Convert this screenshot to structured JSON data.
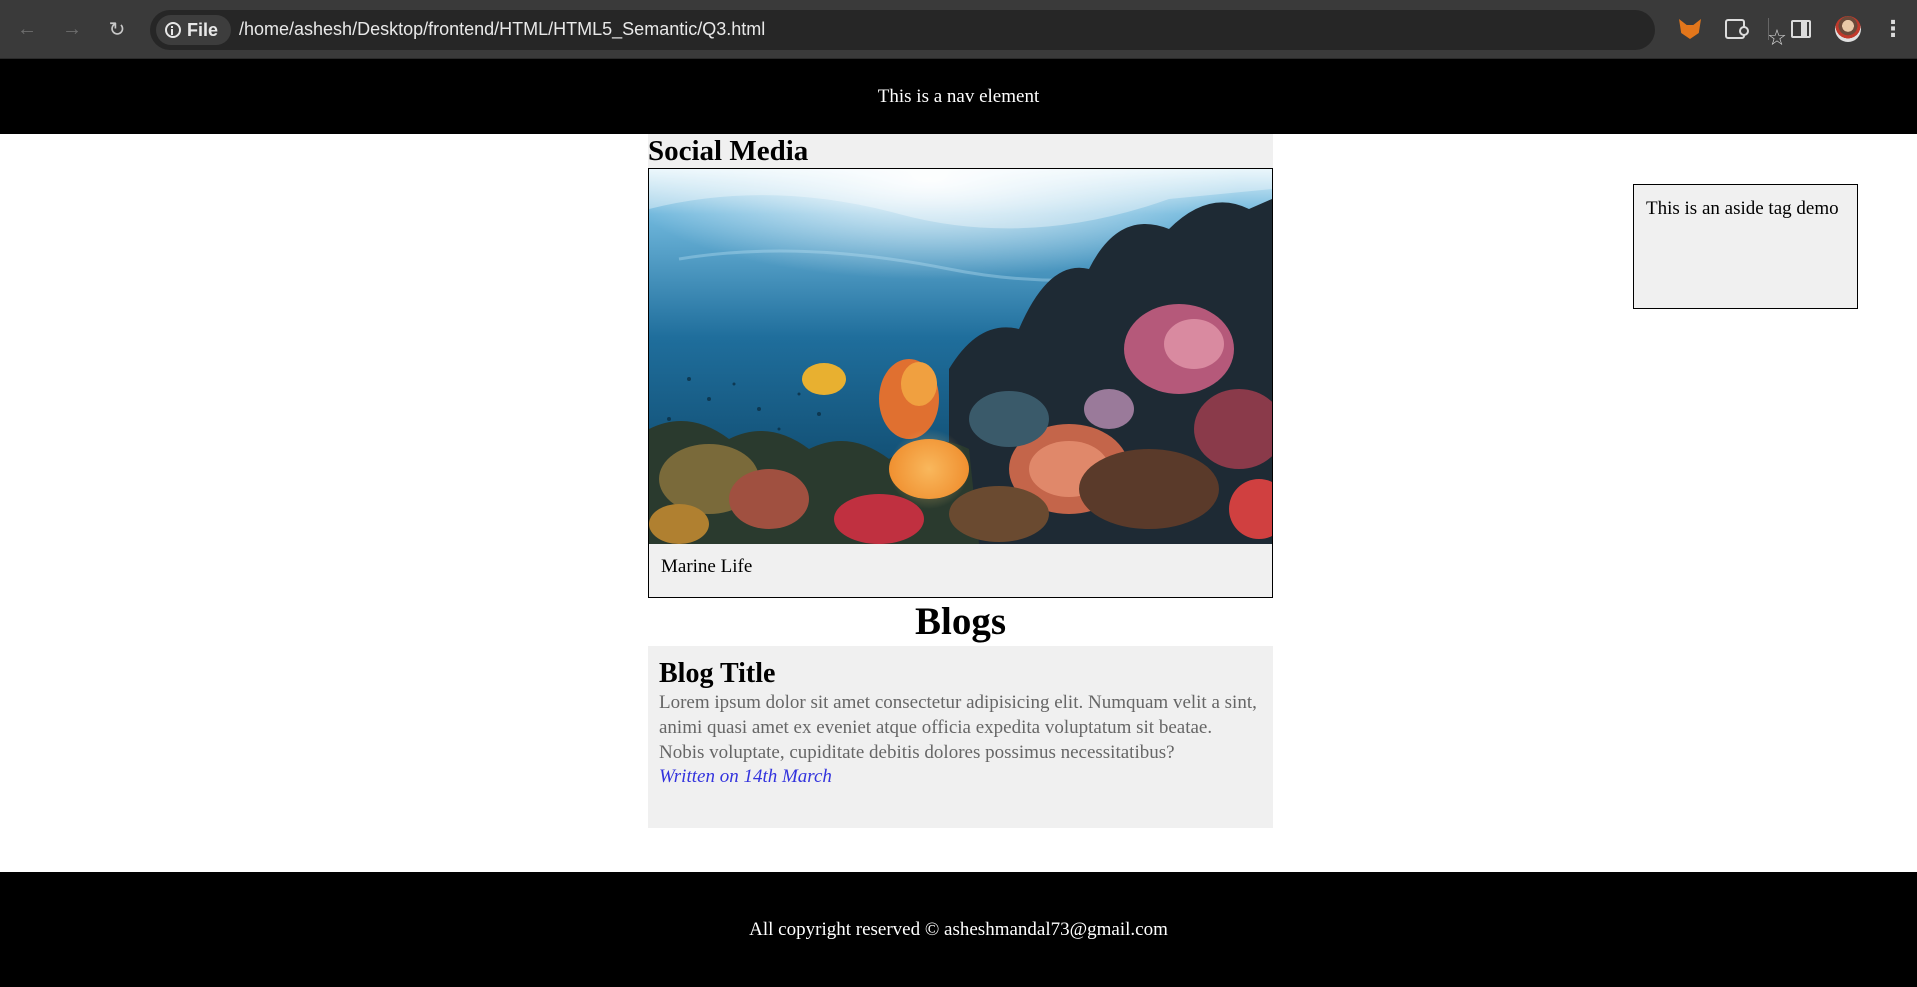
{
  "browser": {
    "site_chip_label": "File",
    "url": "/home/ashesh/Desktop/frontend/HTML/HTML5_Semantic/Q3.html"
  },
  "nav": {
    "text": "This is a nav element"
  },
  "social": {
    "heading": "Social Media",
    "caption": "Marine Life"
  },
  "blogs": {
    "heading": "Blogs",
    "article": {
      "title": "Blog Title",
      "body": "Lorem ipsum dolor sit amet consectetur adipisicing elit. Numquam velit a sint, animi quasi amet ex eveniet atque officia expedita voluptatum sit beatae. Nobis voluptate, cupiditate debitis dolores possimus necessitatibus?",
      "date": "Written on 14th March"
    }
  },
  "aside": {
    "text": "This is an aside tag demo"
  },
  "footer": {
    "text": "All copyright reserved © asheshmandal73@gmail.com"
  },
  "colors": {
    "nav_bg": "#000000",
    "panel_bg": "#f0f0f0",
    "body_text_muted": "#666666",
    "date_link": "#3333dd"
  },
  "icons": [
    "back-arrow-icon",
    "forward-arrow-icon",
    "reload-icon",
    "info-icon",
    "star-icon",
    "metamask-fox-icon",
    "extensions-puzzle-icon",
    "side-panel-icon",
    "profile-avatar-icon",
    "menu-kebab-icon"
  ]
}
